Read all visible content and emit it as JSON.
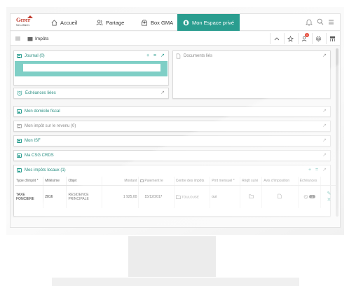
{
  "brand": {
    "logo_main": "Gerer",
    "logo_sub": "Mes Affaires",
    "accent": "#2a9d8f",
    "teal_light": "#7fcfc6"
  },
  "topnav": {
    "items": [
      {
        "label": "Accueil",
        "icon": "home-icon"
      },
      {
        "label": "Partage",
        "icon": "users-icon"
      },
      {
        "label": "Box GMA",
        "icon": "box-icon"
      },
      {
        "label": "Mon Espace privé",
        "icon": "lock-icon",
        "active": true
      }
    ],
    "right_icons": [
      "bell-icon",
      "search-icon",
      "menu-icon"
    ]
  },
  "toolbar": {
    "breadcrumb": "Impôts",
    "right_icons": [
      "chevron-up-icon",
      "star-icon",
      "user-alert-icon",
      "gear-icon",
      "app-icon"
    ],
    "badge_count": "1"
  },
  "panels": {
    "journal": {
      "title": "Journal (0)",
      "actions": [
        "+",
        "=",
        "↗"
      ]
    },
    "documents": {
      "title": "Documents liés",
      "action": "↗"
    },
    "echeances": {
      "title": "Échéances liées",
      "action": "↗"
    },
    "domicile": {
      "title": "Mon domicile fiscal",
      "action": "↗"
    },
    "impot_revenu": {
      "title": "Mon impôt sur le revenu (0)",
      "action": "↗"
    },
    "isf": {
      "title": "Mon ISF",
      "action": "↗"
    },
    "csg": {
      "title": "Ma CSG CRDS",
      "action": "↗"
    },
    "locaux": {
      "title": "Mes impôts locaux (1)",
      "actions": [
        "+",
        "=",
        "↗"
      ]
    }
  },
  "table": {
    "headers": [
      "Type d'impôt *",
      "Millésime",
      "Objet",
      "Montant",
      "Paiement le",
      "Centre des impôts",
      "Pmt mensuel *",
      "Règlt suivi",
      "Avis d'imposition",
      "Échéances",
      ""
    ],
    "row": {
      "type": "TAXE FONCIERE",
      "millesime": "2016",
      "objet": "RESIDENCE PRINCIPALE",
      "montant": "1 925,00",
      "paiement": "15/12/2017",
      "centre": "TOULOUSE",
      "mensuel": "oui",
      "echeances_count": "1"
    }
  }
}
